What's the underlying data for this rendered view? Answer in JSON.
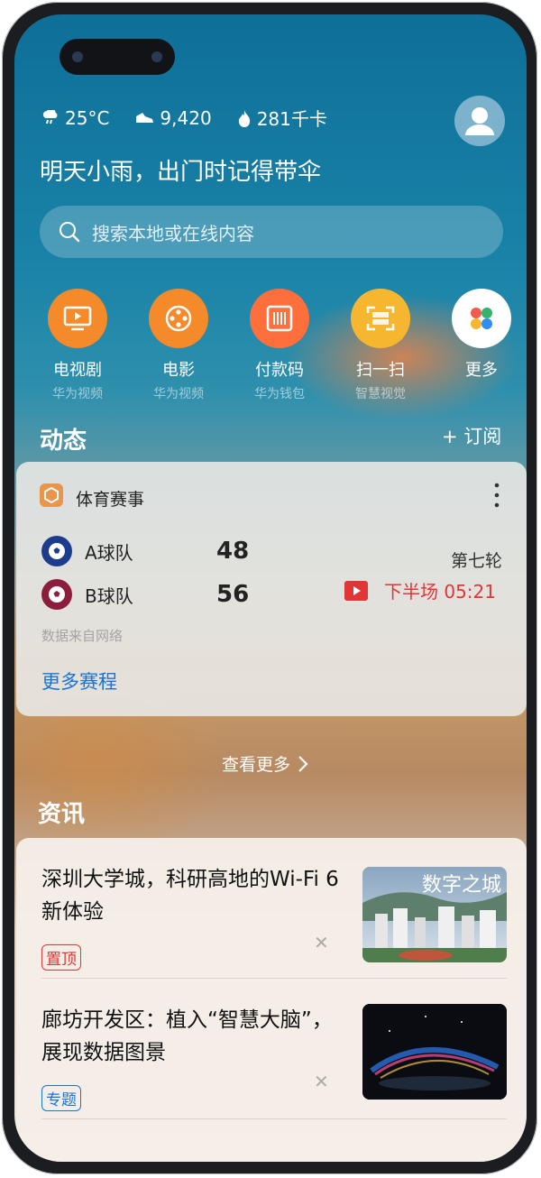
{
  "status": {
    "weather": "25°C",
    "steps": "9,420",
    "calories": "281千卡"
  },
  "headline": "明天小雨，出门时记得带伞",
  "search": {
    "placeholder": "搜索本地或在线内容"
  },
  "apps": [
    {
      "label": "电视剧",
      "sub": "华为视频",
      "icon": "tv-icon",
      "color": "#f58a2a"
    },
    {
      "label": "电影",
      "sub": "华为视频",
      "icon": "film-reel-icon",
      "color": "#f58a2a"
    },
    {
      "label": "付款码",
      "sub": "华为钱包",
      "icon": "barcode-icon",
      "color": "#ff6f3c"
    },
    {
      "label": "扫一扫",
      "sub": "智慧视觉",
      "icon": "scan-icon",
      "color": "#f7b62f"
    },
    {
      "label": "更多",
      "sub": "",
      "icon": "more-apps-icon",
      "color": "#ffffff"
    }
  ],
  "feed": {
    "title": "动态",
    "subscribe": "+ 订阅"
  },
  "sports": {
    "title": "体育赛事",
    "teams": [
      {
        "name": "A球队",
        "score": "48",
        "color": "#1d3c8c"
      },
      {
        "name": "B球队",
        "score": "56",
        "color": "#8c1d3c"
      }
    ],
    "round": "第七轮",
    "live_status": "下半场 05:21",
    "source": "数据来自网络",
    "more": "更多赛程"
  },
  "view_more": "查看更多",
  "news": {
    "title": "资讯",
    "items": [
      {
        "title": "深圳大学城，科研高地的Wi-Fi 6新体验",
        "tag": "置顶",
        "tag_color": "#e23535",
        "image_text": "数字之城"
      },
      {
        "title": "廊坊开发区：植入“智慧大脑”，展现数据图景",
        "tag": "专题",
        "tag_color": "#1a74d6"
      }
    ]
  }
}
